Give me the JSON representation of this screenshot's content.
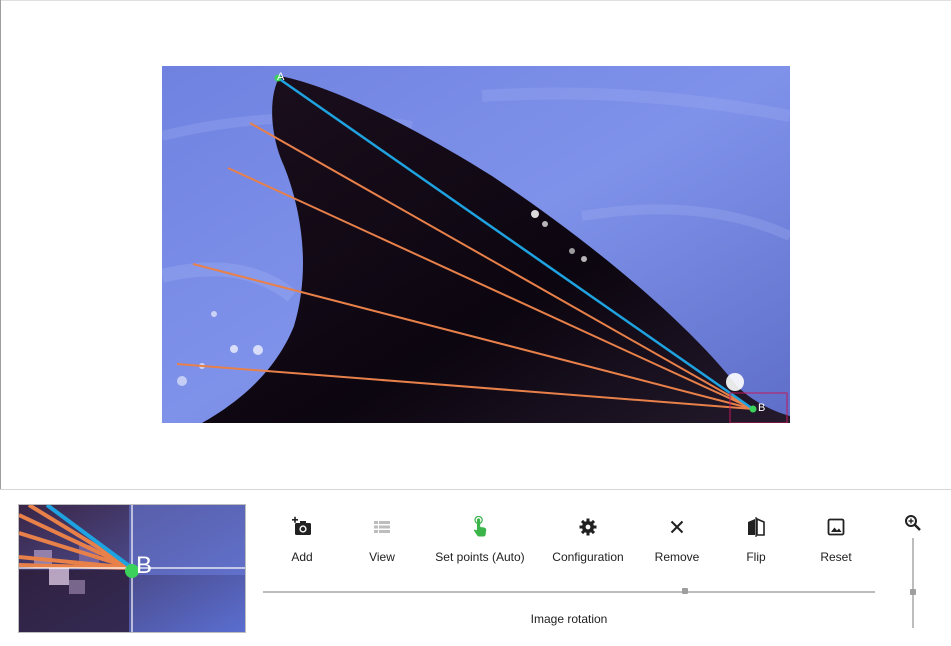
{
  "image": {
    "point_a_label": "A",
    "point_b_label": "B"
  },
  "loupe": {
    "point_label": "B"
  },
  "toolbar": {
    "add_label": "Add",
    "view_label": "View",
    "set_points_label": "Set points (Auto)",
    "configuration_label": "Configuration",
    "remove_label": "Remove",
    "flip_label": "Flip",
    "reset_label": "Reset"
  },
  "rotation": {
    "label": "Image rotation",
    "value_fraction": 0.69
  },
  "zoom": {
    "value_fraction": 0.6
  },
  "icons": {
    "add": "add-photo-icon",
    "view": "list-view-icon",
    "set_points": "touch-pointer-icon",
    "configuration": "gear-icon",
    "remove": "close-icon",
    "flip": "flip-icon",
    "reset": "image-icon",
    "zoom": "zoom-in-icon"
  },
  "colors": {
    "reference_line": "#1fa3e0",
    "measure_lines": "#e8804a",
    "active_icon": "#3bb54a",
    "point_marker": "#3bd15a",
    "loupe_box": "#c2185b"
  }
}
